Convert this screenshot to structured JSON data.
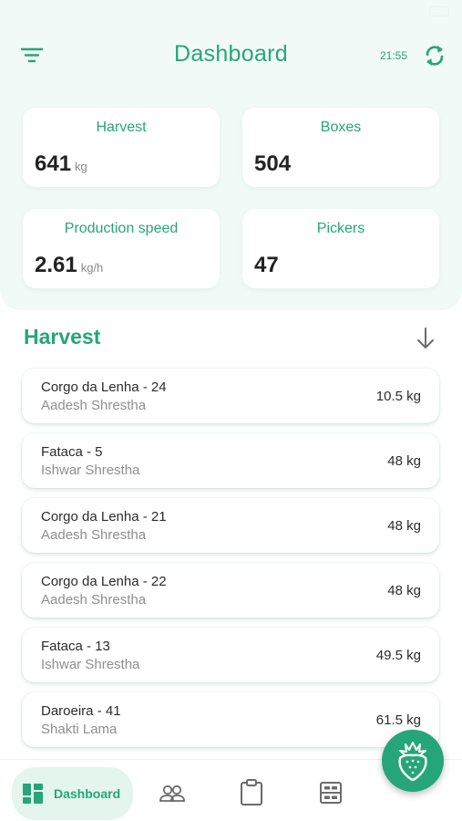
{
  "colors": {
    "accent": "#27a57a",
    "background_top": "#f1faf6"
  },
  "header": {
    "title": "Dashboard",
    "time": "21:55",
    "filter_icon": "filter-icon",
    "sync_icon": "sync-icon"
  },
  "stats": {
    "harvest": {
      "label": "Harvest",
      "value": "641",
      "unit": "kg"
    },
    "boxes": {
      "label": "Boxes",
      "value": "504"
    },
    "speed": {
      "label": "Production speed",
      "value": "2.61",
      "unit": "kg/h"
    },
    "pickers": {
      "label": "Pickers",
      "value": "47"
    }
  },
  "harvest_section": {
    "title": "Harvest",
    "sort_icon": "arrow-down-icon",
    "items": [
      {
        "title": "Corgo da Lenha - 24",
        "picker": "Aadesh Shrestha",
        "weight": "10.5 kg"
      },
      {
        "title": "Fataca - 5",
        "picker": "Ishwar Shrestha",
        "weight": "48 kg"
      },
      {
        "title": "Corgo da Lenha - 21",
        "picker": "Aadesh Shrestha",
        "weight": "48 kg"
      },
      {
        "title": "Corgo da Lenha - 22",
        "picker": "Aadesh Shrestha",
        "weight": "48 kg"
      },
      {
        "title": "Fataca - 13",
        "picker": "Ishwar Shrestha",
        "weight": "49.5 kg"
      },
      {
        "title": "Daroeira - 41",
        "picker": "Shakti Lama",
        "weight": "61.5 kg"
      }
    ]
  },
  "bottom_nav": {
    "items": [
      {
        "label": "Dashboard",
        "icon": "dashboard-icon",
        "active": true
      },
      {
        "icon": "people-icon"
      },
      {
        "icon": "clipboard-icon"
      },
      {
        "icon": "layout-icon"
      }
    ]
  },
  "fab": {
    "icon": "strawberry-icon"
  }
}
